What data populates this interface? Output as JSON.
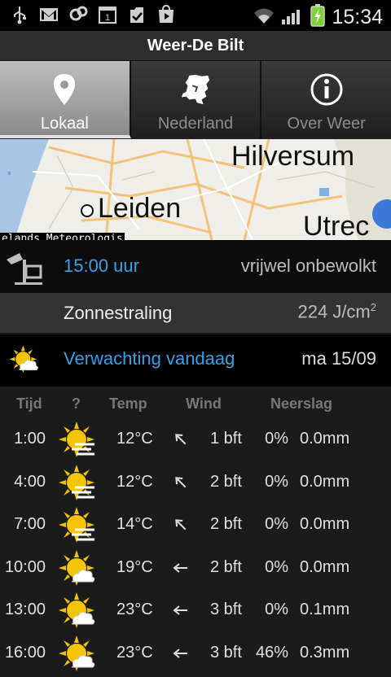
{
  "status_bar": {
    "time": "15:34",
    "icons_left": [
      "usb-icon",
      "gmail-icon",
      "sync-icon",
      "calendar-icon",
      "download-icon",
      "play-store-icon"
    ],
    "calendar_day": "1",
    "icons_right": [
      "wifi-icon",
      "signal-icon",
      "battery-charging-icon"
    ]
  },
  "app": {
    "title": "Weer-De Bilt"
  },
  "tabs": [
    {
      "label": "Lokaal",
      "icon": "location-pin-icon",
      "active": true
    },
    {
      "label": "Nederland",
      "icon": "netherlands-map-icon",
      "active": false
    },
    {
      "label": "Over Weer",
      "icon": "info-icon",
      "active": false
    }
  ],
  "map": {
    "cities": [
      "Hilversum",
      "Leiden",
      "Utrec"
    ],
    "attribution": "elands Meteorologis"
  },
  "observation": {
    "time": "15:00 uur",
    "description": "vrijwel onbewolkt"
  },
  "sunshine": {
    "label": "Zonnestraling",
    "value": "224 J/cm",
    "superscript": "2"
  },
  "forecast": {
    "label": "Verwachting vandaag",
    "date": "ma 15/09"
  },
  "table": {
    "headers": {
      "time": "Tijd",
      "icon": "?",
      "temp": "Temp",
      "wind": "Wind",
      "precip": "Neerslag"
    },
    "rows": [
      {
        "time": "1:00",
        "icon": "sun-fog-icon",
        "temp": "12°C",
        "wind_arrow": "arrow-northwest-icon",
        "wind": "1 bft",
        "pct": "0%",
        "mm": "0.0mm"
      },
      {
        "time": "4:00",
        "icon": "sun-fog-icon",
        "temp": "12°C",
        "wind_arrow": "arrow-northwest-icon",
        "wind": "2 bft",
        "pct": "0%",
        "mm": "0.0mm"
      },
      {
        "time": "7:00",
        "icon": "sun-fog-icon",
        "temp": "14°C",
        "wind_arrow": "arrow-northwest-icon",
        "wind": "2 bft",
        "pct": "0%",
        "mm": "0.0mm"
      },
      {
        "time": "10:00",
        "icon": "sun-cloud-icon",
        "temp": "19°C",
        "wind_arrow": "arrow-west-icon",
        "wind": "2 bft",
        "pct": "0%",
        "mm": "0.0mm"
      },
      {
        "time": "13:00",
        "icon": "sun-cloud-icon",
        "temp": "23°C",
        "wind_arrow": "arrow-west-icon",
        "wind": "3 bft",
        "pct": "0%",
        "mm": "0.1mm"
      },
      {
        "time": "16:00",
        "icon": "sun-cloud-icon",
        "temp": "23°C",
        "wind_arrow": "arrow-west-icon",
        "wind": "3 bft",
        "pct": "46%",
        "mm": "0.3mm"
      }
    ]
  },
  "colors": {
    "accent": "#3aa0e6",
    "background": "#1b1b1b",
    "sun": "#f5c400"
  }
}
